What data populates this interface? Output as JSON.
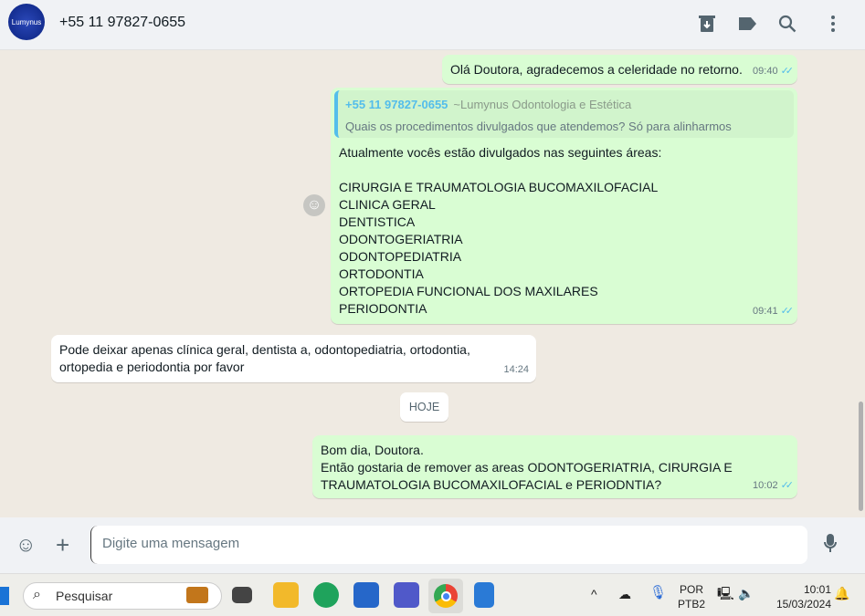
{
  "header": {
    "avatar_text": "Lumynus",
    "contact": "+55 11 97827-0655"
  },
  "messages": [
    {
      "text": "Olá Doutora, agradecemos a celeridade no retorno.",
      "time": "09:40"
    },
    {
      "quote_name": "+55 11 97827-0655",
      "quote_sub": "~Lumynus Odontologia e Estética",
      "quote_text": "Quais os procedimentos divulgados que atendemos? Só para alinharmos",
      "intro": "Atualmente vocês estão divulgados nas seguintes áreas:",
      "items": [
        "CIRURGIA E TRAUMATOLOGIA BUCOMAXILOFACIAL",
        "CLINICA GERAL",
        "DENTISTICA",
        "ODONTOGERIATRIA",
        "ODONTOPEDIATRIA",
        "ORTODONTIA",
        "ORTOPEDIA FUNCIONAL DOS MAXILARES",
        "PERIODONTIA"
      ],
      "time": "09:41"
    },
    {
      "line1": "Pode deixar apenas clínica geral, dentista a, odontopediatria, ortodontia,",
      "line2": "ortopedia e periodontia por favor",
      "time": "14:24"
    },
    {
      "line1": "Bom dia, Doutora.",
      "line2": "Então gostaria de remover as areas ODONTOGERIATRIA, CIRURGIA E",
      "line3": "TRAUMATOLOGIA BUCOMAXILOFACIAL e PERIODNTIA?",
      "time": "10:02"
    }
  ],
  "date_chip": "HOJE",
  "input": {
    "placeholder": "Digite uma mensagem"
  },
  "taskbar": {
    "search": "Pesquisar",
    "lang1": "POR",
    "lang2": "PTB2",
    "time": "10:01",
    "date": "15/03/2024"
  },
  "colors": {
    "outgoing": "#d9fdd3",
    "accent": "#53bdeb"
  }
}
